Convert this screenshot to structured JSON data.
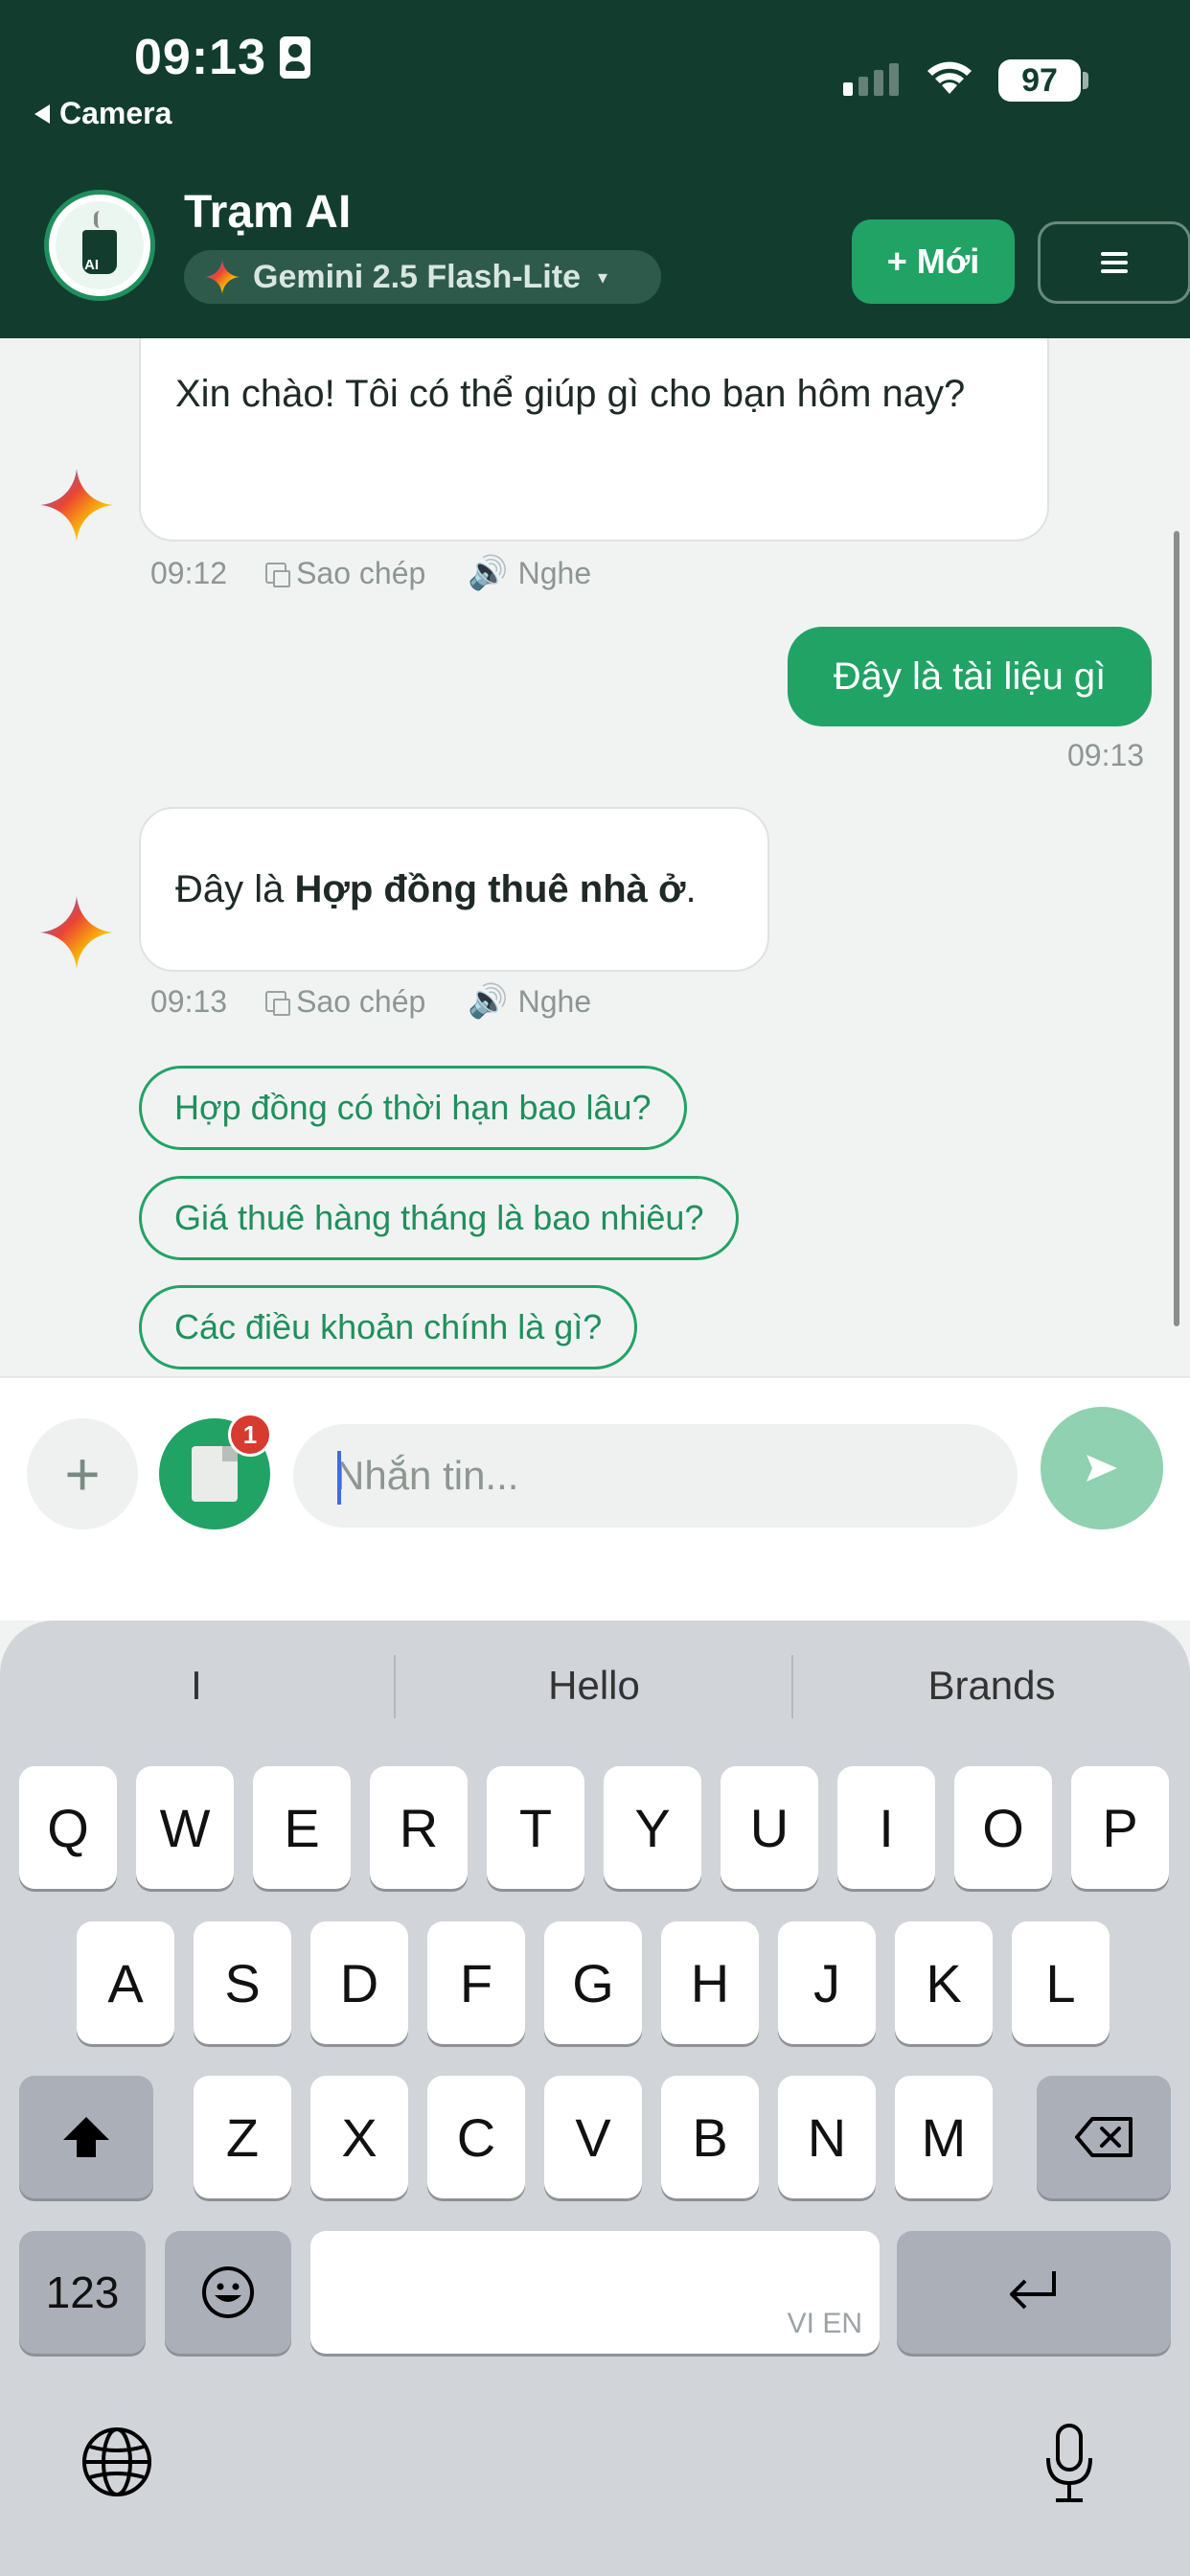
{
  "status_bar": {
    "time": "09:13",
    "back_label": "Camera",
    "battery": "97"
  },
  "header": {
    "app_title": "Trạm AI",
    "model_name": "Gemini 2.5 Flash-Lite",
    "model_caret": "▾",
    "new_button": "+ Mới",
    "menu_icon": "hamburger-menu-icon",
    "logo_text": "AI"
  },
  "messages": [
    {
      "role": "assistant",
      "text": "Xin chào! Tôi có thể giúp gì cho bạn hôm nay?",
      "time": "09:12",
      "copy_label": "Sao chép",
      "listen_label": "Nghe"
    },
    {
      "role": "user",
      "text": "Đây là tài liệu gì",
      "time": "09:13"
    },
    {
      "role": "assistant",
      "text_prefix": "Đây là ",
      "text_bold": "Hợp đồng thuê nhà ở",
      "text_suffix": ".",
      "time": "09:13",
      "copy_label": "Sao chép",
      "listen_label": "Nghe"
    }
  ],
  "suggestions": [
    "Hợp đồng có thời hạn bao lâu?",
    "Giá thuê hàng tháng là bao nhiêu?",
    "Các điều khoản chính là gì?"
  ],
  "composer": {
    "plus": "+",
    "file_badge": "1",
    "placeholder": "Nhắn tin...",
    "send_icon": "send-arrow-icon"
  },
  "keyboard": {
    "predictions": [
      "I",
      "Hello",
      "Brands"
    ],
    "row1": [
      "Q",
      "W",
      "E",
      "R",
      "T",
      "Y",
      "U",
      "I",
      "O",
      "P"
    ],
    "row2": [
      "A",
      "S",
      "D",
      "F",
      "G",
      "H",
      "J",
      "K",
      "L"
    ],
    "row3": [
      "Z",
      "X",
      "C",
      "V",
      "B",
      "N",
      "M"
    ],
    "numbers_key": "123",
    "space_lang": "VI EN"
  },
  "colors": {
    "header_bg": "#123d2e",
    "accent": "#21a366",
    "send_disabled": "#8fd1b0",
    "badge": "#d73a2f"
  }
}
